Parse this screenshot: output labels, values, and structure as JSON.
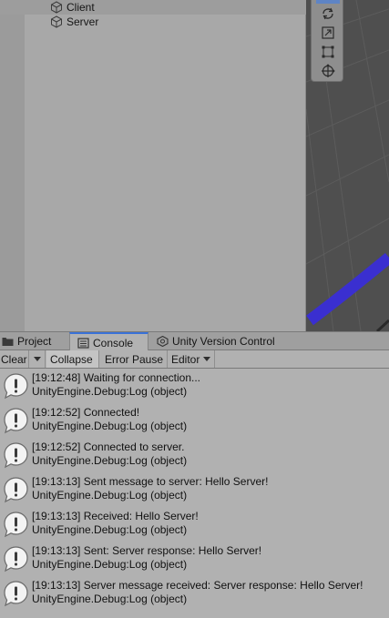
{
  "hierarchy": {
    "items": [
      {
        "label": "Client",
        "icon": "gameobject-cube-icon",
        "selected": true
      },
      {
        "label": "Server",
        "icon": "gameobject-cube-icon",
        "selected": false
      }
    ]
  },
  "scene_tools": [
    "rotate-tool-icon",
    "scale-tool-icon",
    "rect-tool-icon",
    "transform-tool-icon"
  ],
  "tabs": [
    {
      "label": "Project",
      "icon": "folder-icon",
      "active": false
    },
    {
      "label": "Console",
      "icon": "console-icon",
      "active": true
    },
    {
      "label": "Unity Version Control",
      "icon": "version-control-icon",
      "active": false
    }
  ],
  "toolbar": {
    "clear_label": "Clear",
    "collapse_label": "Collapse",
    "error_pause_label": "Error Pause",
    "editor_label": "Editor"
  },
  "logs": [
    {
      "message": "[19:12:48] Waiting for connection...",
      "source": "UnityEngine.Debug:Log (object)"
    },
    {
      "message": "[19:12:52] Connected!",
      "source": "UnityEngine.Debug:Log (object)"
    },
    {
      "message": "[19:12:52] Connected to server.",
      "source": "UnityEngine.Debug:Log (object)"
    },
    {
      "message": "[19:13:13] Sent message to server: Hello Server!",
      "source": "UnityEngine.Debug:Log (object)"
    },
    {
      "message": "[19:13:13] Received: Hello Server!",
      "source": "UnityEngine.Debug:Log (object)"
    },
    {
      "message": "[19:13:13] Sent: Server response: Hello Server!",
      "source": "UnityEngine.Debug:Log (object)"
    },
    {
      "message": "[19:13:13] Server message received: Server response: Hello Server!",
      "source": "UnityEngine.Debug:Log (object)"
    }
  ],
  "colors": {
    "tab_accent": "#3a72d8",
    "scene_highlight": "#3a2fd0",
    "active_tool": "#5e84c5"
  }
}
